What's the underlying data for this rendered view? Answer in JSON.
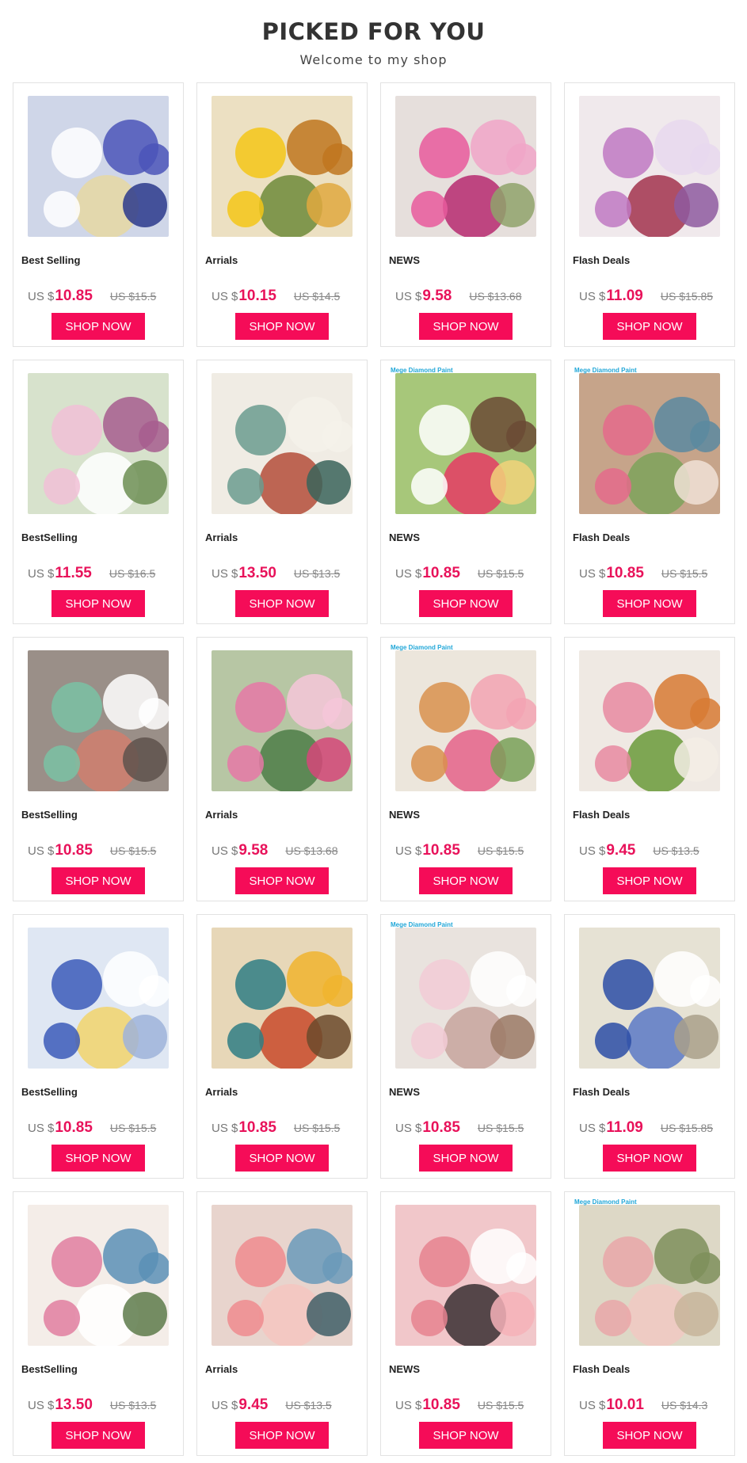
{
  "header": {
    "title": "PICKED FOR YOU",
    "subtitle": "Welcome to my shop"
  },
  "currency": "US $",
  "button_label": "SHOP NOW",
  "colors": {
    "accent": "#f50c58",
    "price": "#e8125a",
    "title_highlight": "#f5d6e0"
  },
  "products": [
    {
      "label": "Best Selling",
      "price": "10.85",
      "old": "US $15.5",
      "brand": "",
      "bg": "#cfd6e8",
      "accents": [
        "#ffffff",
        "#4b55b8",
        "#e6d8a2",
        "#2b3a8c"
      ]
    },
    {
      "label": "Arrials",
      "price": "10.15",
      "old": "US $14.5",
      "brand": "",
      "bg": "#ece0c2",
      "accents": [
        "#f5c518",
        "#c0761f",
        "#6f8a3a",
        "#e0a840"
      ]
    },
    {
      "label": "NEWS",
      "price": "9.58",
      "old": "US $13.68",
      "brand": "",
      "bg": "#e6dfdc",
      "accents": [
        "#e75b9c",
        "#f0a6c8",
        "#b62a70",
        "#8fa36b"
      ]
    },
    {
      "label": "Flash Deals",
      "price": "11.09",
      "old": "US $15.85",
      "brand": "",
      "bg": "#f0e9ec",
      "accents": [
        "#c079c3",
        "#e8d8ef",
        "#a2324d",
        "#8e5aa0"
      ]
    },
    {
      "label": "BestSelling",
      "price": "11.55",
      "old": "US $16.5",
      "brand": "",
      "bg": "#d7e2cc",
      "accents": [
        "#f1bfd6",
        "#a75d8e",
        "#ffffff",
        "#6d8e53"
      ]
    },
    {
      "label": "Arrials",
      "price": "13.50",
      "old": "US $13.5",
      "brand": "",
      "bg": "#f0ece4",
      "accents": [
        "#6b9c8f",
        "#f5f2ea",
        "#b44d3a",
        "#39645a"
      ]
    },
    {
      "label": "NEWS",
      "price": "10.85",
      "old": "US $15.5",
      "brand": "Mege Diamond Paint",
      "bg": "#a7c77a",
      "accents": [
        "#ffffff",
        "#6b4a35",
        "#e53b64",
        "#f1d27a"
      ]
    },
    {
      "label": "Flash Deals",
      "price": "10.85",
      "old": "US $15.5",
      "brand": "Mege Diamond Paint",
      "bg": "#c6a48a",
      "accents": [
        "#e46b8b",
        "#5a8aa0",
        "#7ca35a",
        "#f0e2d6"
      ]
    },
    {
      "label": "BestSelling",
      "price": "10.85",
      "old": "US $15.5",
      "brand": "",
      "bg": "#9a8f88",
      "accents": [
        "#7ac2a4",
        "#ffffff",
        "#d07f6f",
        "#5e524c"
      ]
    },
    {
      "label": "Arrials",
      "price": "9.58",
      "old": "US $13.68",
      "brand": "",
      "bg": "#b7c6a4",
      "accents": [
        "#e678a7",
        "#f6c6d9",
        "#4d7d48",
        "#d6467a"
      ]
    },
    {
      "label": "NEWS",
      "price": "10.85",
      "old": "US $15.5",
      "brand": "Mege Diamond Paint",
      "bg": "#ece6dc",
      "accents": [
        "#d9904e",
        "#f3a3b3",
        "#e5628a",
        "#79a058"
      ]
    },
    {
      "label": "Flash Deals",
      "price": "9.45",
      "old": "US $13.5",
      "brand": "",
      "bg": "#efe9e3",
      "accents": [
        "#e88aa1",
        "#d77a34",
        "#6a9a3a",
        "#f3ede5"
      ]
    },
    {
      "label": "BestSelling",
      "price": "10.85",
      "old": "US $15.5",
      "brand": "",
      "bg": "#dfe7f3",
      "accents": [
        "#3c5bb8",
        "#ffffff",
        "#f2d36b",
        "#9fb3d9"
      ]
    },
    {
      "label": "Arrials",
      "price": "10.85",
      "old": "US $15.5",
      "brand": "",
      "bg": "#e7d7b8",
      "accents": [
        "#2f7e84",
        "#f0b42e",
        "#c84a2a",
        "#6b4a2c"
      ]
    },
    {
      "label": "NEWS",
      "price": "10.85",
      "old": "US $15.5",
      "brand": "Mege Diamond Paint",
      "bg": "#e9e3de",
      "accents": [
        "#f2cbd6",
        "#ffffff",
        "#c7a59e",
        "#9b7a66"
      ]
    },
    {
      "label": "Flash Deals",
      "price": "11.09",
      "old": "US $15.85",
      "brand": "",
      "bg": "#e6e2d4",
      "accents": [
        "#2b4ea6",
        "#ffffff",
        "#5b79c6",
        "#a9a08a"
      ]
    },
    {
      "label": "BestSelling",
      "price": "13.50",
      "old": "US $13.5",
      "brand": "",
      "bg": "#f4ede8",
      "accents": [
        "#e07ea0",
        "#5b8fb6",
        "#ffffff",
        "#5d7a4a"
      ]
    },
    {
      "label": "Arrials",
      "price": "9.45",
      "old": "US $13.5",
      "brand": "",
      "bg": "#e8d4cd",
      "accents": [
        "#ef8b8e",
        "#6a9aba",
        "#f5c6c0",
        "#3f5f67"
      ]
    },
    {
      "label": "NEWS",
      "price": "10.85",
      "old": "US $15.5",
      "brand": "",
      "bg": "#f1c7ca",
      "accents": [
        "#e6828f",
        "#ffffff",
        "#3a2f32",
        "#f6b2b8"
      ]
    },
    {
      "label": "Flash Deals",
      "price": "10.01",
      "old": "US $14.3",
      "brand": "Mege Diamond Paint",
      "bg": "#ddd8c6",
      "accents": [
        "#e9a7a8",
        "#7e8f5b",
        "#f1c9c2",
        "#c7b59a"
      ]
    }
  ]
}
